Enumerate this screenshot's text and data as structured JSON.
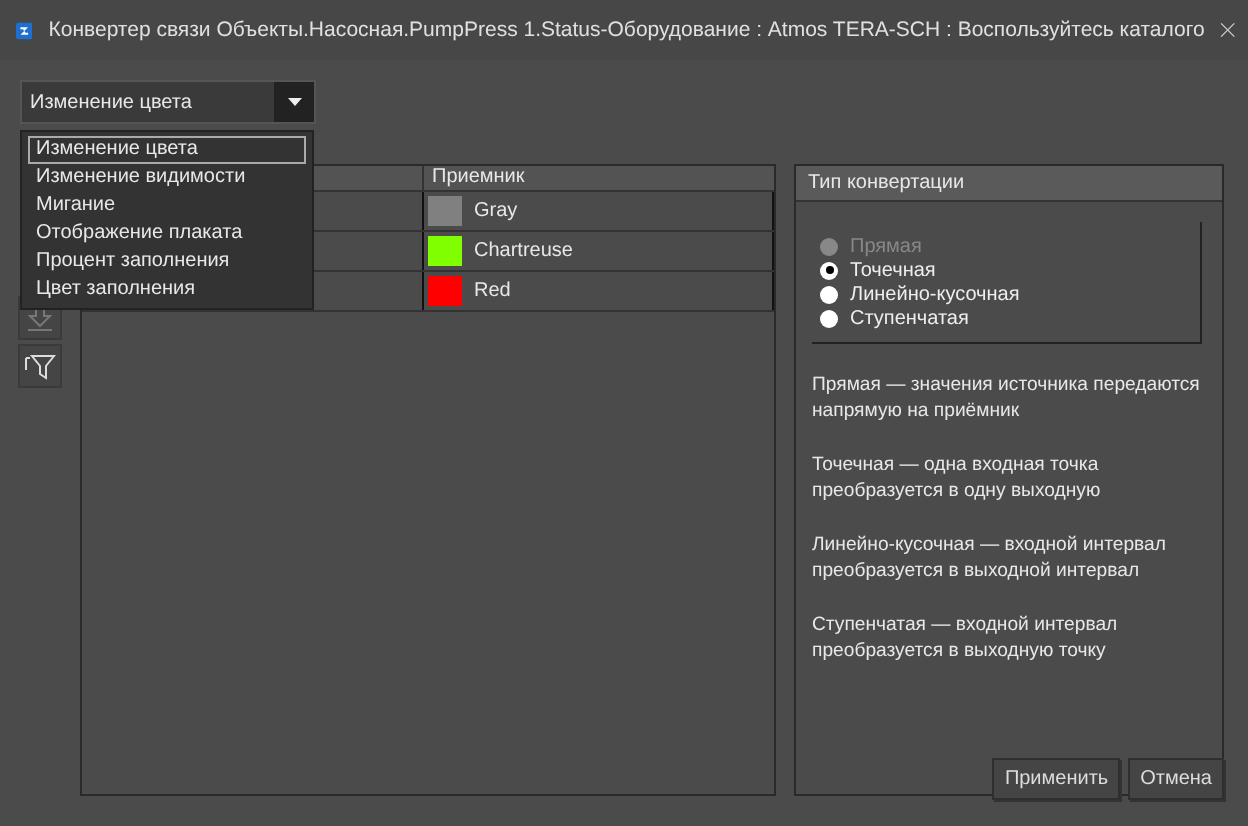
{
  "window": {
    "title": "Конвертер связи Объекты.Насосная.PumpPress 1.Status-Оборудование : Atmos TERA-SCH : Воспользуйтесь каталого"
  },
  "dropdown": {
    "value": "Изменение цвета",
    "expanded": true,
    "options": [
      {
        "label": "Изменение цвета",
        "selected": true
      },
      {
        "label": "Изменение видимости",
        "selected": false
      },
      {
        "label": "Мигание",
        "selected": false
      },
      {
        "label": "Отображение плаката",
        "selected": false
      },
      {
        "label": "Процент заполнения",
        "selected": false
      },
      {
        "label": "Цвет заполнения",
        "selected": false
      }
    ]
  },
  "toolbar": [
    {
      "kind": "download",
      "disabled": true
    },
    {
      "kind": "filter",
      "disabled": false
    }
  ],
  "table": {
    "columns": [
      "Приемник"
    ],
    "rows": [
      {
        "receiver": "Gray",
        "color": "#808080"
      },
      {
        "receiver": "Chartreuse",
        "color": "#7fff00"
      },
      {
        "receiver": "Red",
        "color": "#ff0000"
      }
    ]
  },
  "conversion": {
    "title": "Тип конвертации",
    "options": [
      {
        "label": "Прямая",
        "selected": false,
        "disabled": true
      },
      {
        "label": "Точечная",
        "selected": true,
        "disabled": false
      },
      {
        "label": "Линейно-кусочная",
        "selected": false,
        "disabled": false
      },
      {
        "label": "Ступенчатая",
        "selected": false,
        "disabled": false
      }
    ],
    "descriptions": [
      "Прямая — значения источника передаются напрямую на приёмник",
      "Точечная — одна входная точка преобразуется в одну выходную",
      "Линейно-кусочная — входной интервал преобразуется в выходной интервал",
      "Ступенчатая — входной интервал преобразуется в выходную точку"
    ]
  },
  "buttons": [
    "Применить",
    "Отмена"
  ]
}
